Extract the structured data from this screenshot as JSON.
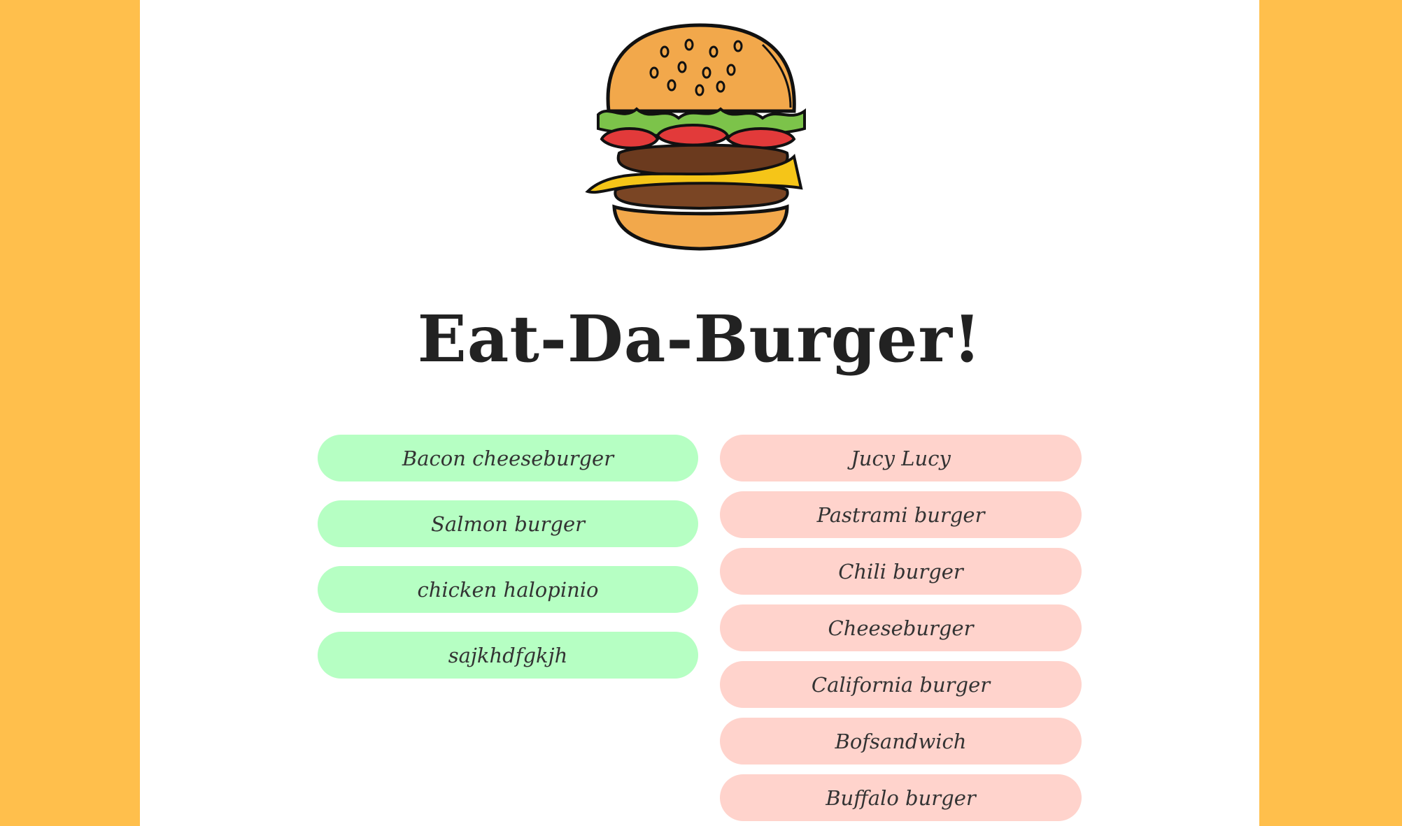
{
  "header": {
    "title": "Eat-Da-Burger!"
  },
  "colors": {
    "side_panel": "#FFBF4C",
    "left_pill": "#B6FFC3",
    "right_pill": "#FFD3CC"
  },
  "left_burgers": [
    {
      "label": "Bacon cheeseburger"
    },
    {
      "label": "Salmon burger"
    },
    {
      "label": "chicken halopinio"
    },
    {
      "label": "sajkhdfgkjh"
    }
  ],
  "right_burgers": [
    {
      "label": "Jucy Lucy"
    },
    {
      "label": "Pastrami burger"
    },
    {
      "label": "Chili burger"
    },
    {
      "label": "Cheeseburger"
    },
    {
      "label": "California burger"
    },
    {
      "label": "Bofsandwich"
    },
    {
      "label": "Buffalo burger"
    }
  ]
}
